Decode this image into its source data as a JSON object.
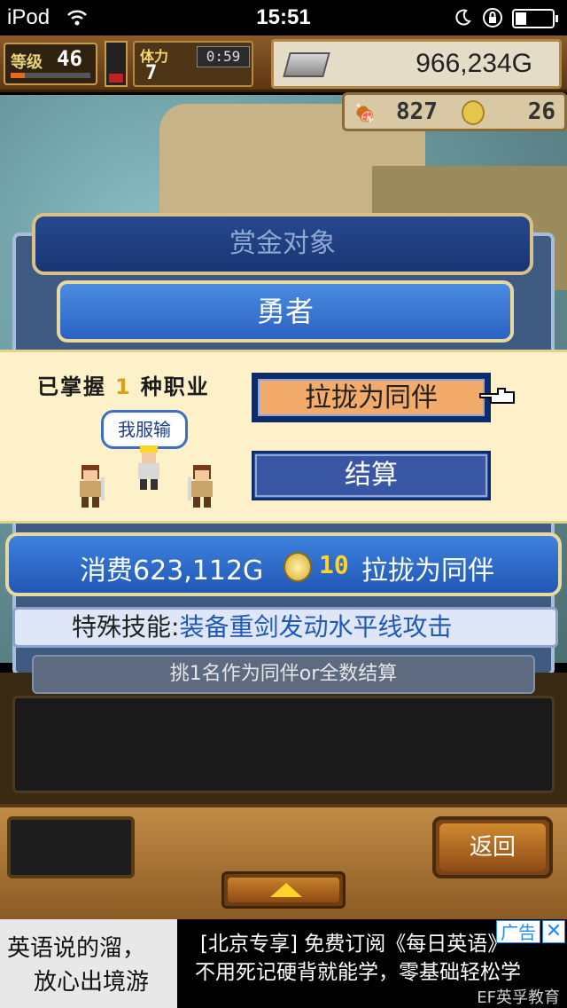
{
  "status_bar": {
    "carrier": "iPod",
    "time": "15:51"
  },
  "hud": {
    "level_label": "等级",
    "level": "46",
    "stamina_label": "体力",
    "stamina": "7",
    "timer": "0:59",
    "money": "966,234G",
    "food": "827",
    "medals": "26"
  },
  "dialog": {
    "title": "赏金对象",
    "tab": "勇者",
    "learned_prefix": "已掌握",
    "learned_count": "1",
    "learned_suffix": "种职业",
    "speech": "我服输",
    "recruit_label": "拉拢为同伴",
    "settle_label": "结算",
    "cost_text": "消费623,112G",
    "cost_coins": "10",
    "cost_action": "拉拢为同伴",
    "skill_prefix": "特殊技能:",
    "skill_name": "装备重剑发动水平线攻击",
    "hint": "挑1名作为同伴or全数结算"
  },
  "bottom": {
    "back_label": "返回"
  },
  "ad": {
    "slogan_line1": "英语说的溜，",
    "slogan_line2": "放心出境游",
    "text_line1": "[北京专享] 免费订阅《每日英语》",
    "text_line2": "不用死记硬背就能学，零基础轻松学",
    "brand": "EF英孚教育",
    "tag": "广告",
    "close": "✕"
  },
  "colors": {
    "accent_blue": "#2a63c4",
    "recruit_orange": "#f3ab6a",
    "gold": "#ffd42a",
    "panel_cream": "#fcf1c9"
  }
}
